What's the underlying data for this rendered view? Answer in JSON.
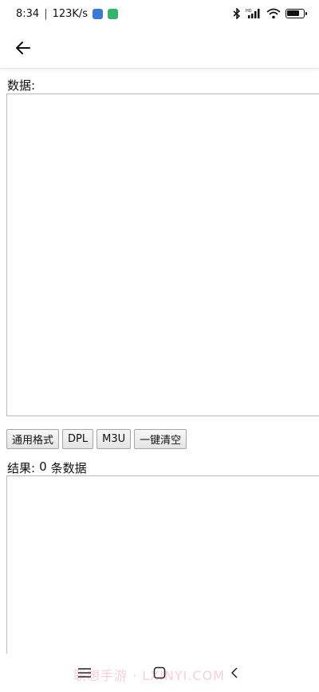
{
  "status_bar": {
    "time": "8:34",
    "network_speed": "123K/s",
    "battery_level": 0.78,
    "icons": [
      "app-notification-icon",
      "app-notification-icon",
      "bluetooth-icon",
      "hd-signal-icon",
      "wifi-icon",
      "battery-icon"
    ]
  },
  "app_bar": {
    "back_icon": "arrow-left-icon"
  },
  "data_section": {
    "label": "数据:",
    "value": ""
  },
  "format_buttons": {
    "general": "通用格式",
    "dpl": "DPL",
    "m3u": "M3U",
    "clear": "一键清空"
  },
  "result_section": {
    "label_prefix": "结果:",
    "count": "0",
    "label_suffix": "条数据",
    "value": ""
  },
  "nav_bar": {
    "icons": [
      "menu-icon",
      "home-icon",
      "back-icon"
    ]
  },
  "watermark": "联想手游 · LXINYI.COM",
  "colors": {
    "border": "#b9b9b9",
    "button_bg": "#eeeeee"
  }
}
